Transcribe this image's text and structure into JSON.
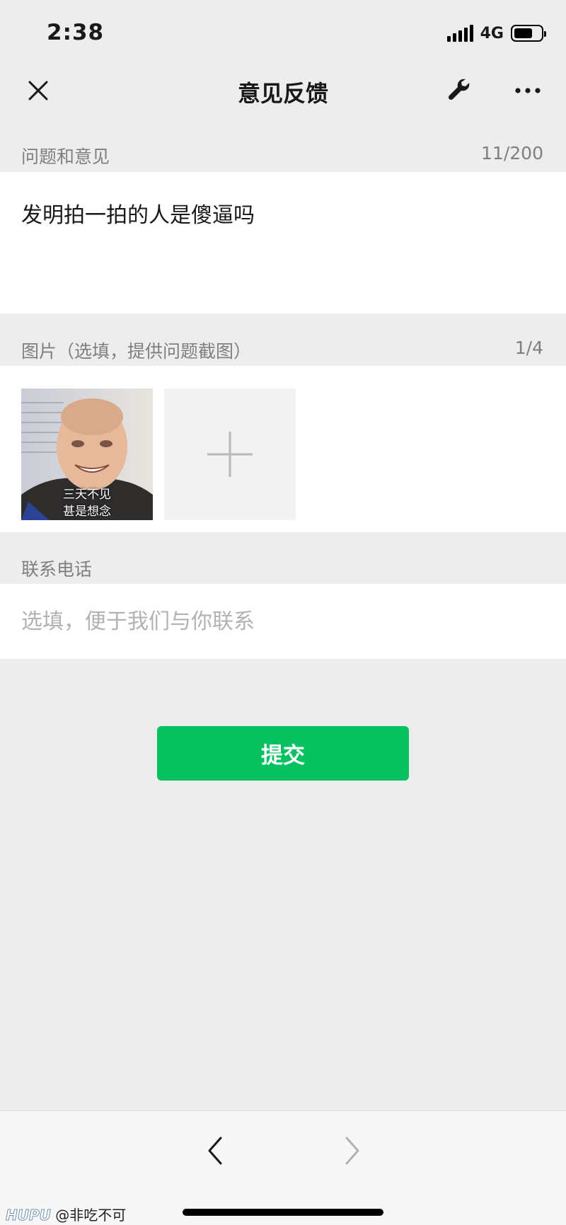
{
  "status_bar": {
    "time": "2:38",
    "network": "4G",
    "battery_level": 0.7
  },
  "nav": {
    "title": "意见反馈",
    "close_icon": "close-icon",
    "wrench_icon": "wrench-icon",
    "more_icon": "more-icon"
  },
  "feedback": {
    "label": "问题和意见",
    "count": "11/200",
    "text": "发明拍一拍的人是傻逼吗"
  },
  "images": {
    "label": "图片（选填，提供问题截图）",
    "count": "1/4",
    "thumbnail_caption_line1": "三天不见",
    "thumbnail_caption_line2": "甚是想念",
    "add_icon": "plus-icon"
  },
  "contact": {
    "label": "联系电话",
    "value": "",
    "placeholder": "选填，便于我们与你联系"
  },
  "submit_label": "提交",
  "bottom_nav": {
    "back_icon": "chevron-left-icon",
    "forward_icon": "chevron-right-icon"
  },
  "watermark": {
    "brand": "HUPU",
    "user": "@非吃不可"
  },
  "colors": {
    "accent": "#07c160",
    "background": "#ededed",
    "panel": "#ffffff",
    "label": "#7f7f7f",
    "placeholder": "#b2b2b2"
  }
}
